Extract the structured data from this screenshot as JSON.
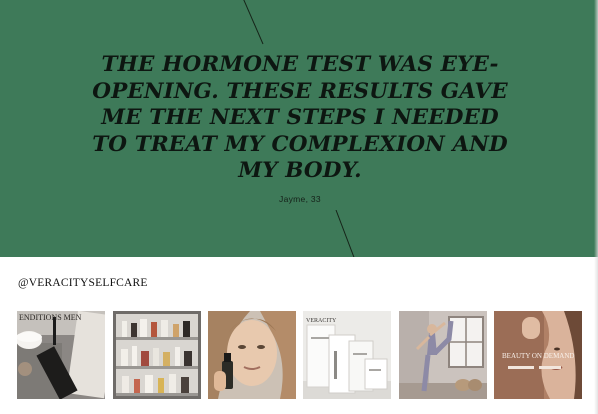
{
  "testimonial": {
    "quote": "The hormone test was eye-opening. These results gave me the next steps I needed to treat my complexion and my body.",
    "author": "Jayme, 33"
  },
  "instagram": {
    "handle": "@VERACITYSELFCARE",
    "posts": [
      {
        "label": "skincare flat lay post",
        "image_text": "ENDITIONS MEN"
      },
      {
        "label": "bathroom shelf products post",
        "image_text": ""
      },
      {
        "label": "model with serum dropper post",
        "image_text": ""
      },
      {
        "label": "veracity product boxes post",
        "image_text": "VERACITY"
      },
      {
        "label": "yoga pose post",
        "image_text": ""
      },
      {
        "label": "beauty on demand post",
        "image_text": "BEAUTY ON DEMAND"
      }
    ]
  },
  "colors": {
    "hero_bg": "#3e7a59",
    "quote_text": "#0d1611",
    "page_bg": "#ffffff"
  },
  "icons": {
    "hero_divider": "diagonal-line",
    "posts": "photo-thumbnail"
  }
}
